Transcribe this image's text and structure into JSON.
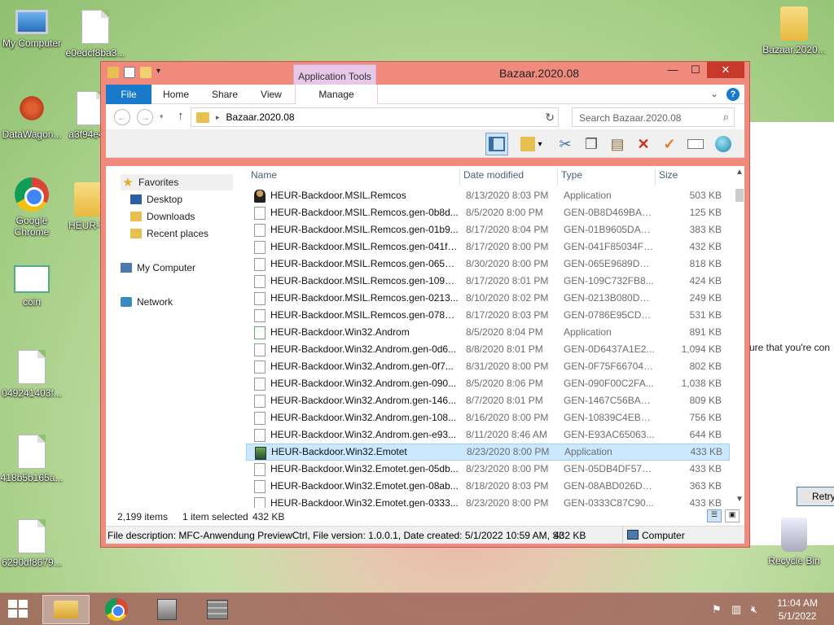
{
  "desktop": {
    "icons": [
      {
        "label": "My Computer"
      },
      {
        "label": "e0edcf8ba3..."
      },
      {
        "label": "DataWagon..."
      },
      {
        "label": "a3f94e4..."
      },
      {
        "label": "Google Chrome"
      },
      {
        "label": "HEUR-T..."
      },
      {
        "label": "coin"
      },
      {
        "label": "049241403f..."
      },
      {
        "label": "418b5b165a..."
      },
      {
        "label": "6290df8679..."
      },
      {
        "label": "Bazaar.2020..."
      },
      {
        "label": "Recycle Bin"
      }
    ],
    "background_panel": {
      "message": "ure that you're con",
      "retry_label": "Retry"
    }
  },
  "window": {
    "title": "Bazaar.2020.08",
    "contextual_tab": "Application Tools",
    "controls": {
      "minimize": "—",
      "maximize": "☐",
      "close": "✕"
    },
    "ribbon_tabs": [
      "File",
      "Home",
      "Share",
      "View"
    ],
    "manage_tab": "Manage",
    "address": {
      "path": "Bazaar.2020.08",
      "separator": "▸"
    },
    "search": {
      "placeholder": "Search Bazaar.2020.08"
    },
    "nav": {
      "favorites": "Favorites",
      "desktop": "Desktop",
      "downloads": "Downloads",
      "recent": "Recent places",
      "my_computer": "My Computer",
      "network": "Network"
    },
    "columns": {
      "name": "Name",
      "date": "Date modified",
      "type": "Type",
      "size": "Size"
    },
    "files": [
      {
        "name": "HEUR-Backdoor.MSIL.Remcos",
        "date": "8/13/2020 8:03 PM",
        "type": "Application",
        "size": "503 KB",
        "icon": "person"
      },
      {
        "name": "HEUR-Backdoor.MSIL.Remcos.gen-0b8d...",
        "date": "8/5/2020 8:00 PM",
        "type": "GEN-0B8D469BAB...",
        "size": "125 KB",
        "icon": "blank"
      },
      {
        "name": "HEUR-Backdoor.MSIL.Remcos.gen-01b9...",
        "date": "8/17/2020 8:04 PM",
        "type": "GEN-01B9605DAA...",
        "size": "383 KB",
        "icon": "blank"
      },
      {
        "name": "HEUR-Backdoor.MSIL.Remcos.gen-041f8...",
        "date": "8/17/2020 8:00 PM",
        "type": "GEN-041F85034F7...",
        "size": "432 KB",
        "icon": "blank"
      },
      {
        "name": "HEUR-Backdoor.MSIL.Remcos.gen-065e9...",
        "date": "8/30/2020 8:00 PM",
        "type": "GEN-065E9689D2B...",
        "size": "818 KB",
        "icon": "blank"
      },
      {
        "name": "HEUR-Backdoor.MSIL.Remcos.gen-109c7...",
        "date": "8/17/2020 8:01 PM",
        "type": "GEN-109C732FB8...",
        "size": "424 KB",
        "icon": "blank"
      },
      {
        "name": "HEUR-Backdoor.MSIL.Remcos.gen-0213...",
        "date": "8/10/2020 8:02 PM",
        "type": "GEN-0213B080D6E...",
        "size": "249 KB",
        "icon": "blank"
      },
      {
        "name": "HEUR-Backdoor.MSIL.Remcos.gen-0786e...",
        "date": "8/17/2020 8:03 PM",
        "type": "GEN-0786E95CD6...",
        "size": "531 KB",
        "icon": "blank"
      },
      {
        "name": "HEUR-Backdoor.Win32.Androm",
        "date": "8/5/2020 8:04 PM",
        "type": "Application",
        "size": "891 KB",
        "icon": "scroll"
      },
      {
        "name": "HEUR-Backdoor.Win32.Androm.gen-0d6...",
        "date": "8/8/2020 8:01 PM",
        "type": "GEN-0D6437A1E2...",
        "size": "1,094 KB",
        "icon": "blank"
      },
      {
        "name": "HEUR-Backdoor.Win32.Androm.gen-0f7...",
        "date": "8/31/2020 8:00 PM",
        "type": "GEN-0F75F667048...",
        "size": "802 KB",
        "icon": "blank"
      },
      {
        "name": "HEUR-Backdoor.Win32.Androm.gen-090...",
        "date": "8/5/2020 8:06 PM",
        "type": "GEN-090F00C2FA...",
        "size": "1,038 KB",
        "icon": "blank"
      },
      {
        "name": "HEUR-Backdoor.Win32.Androm.gen-146...",
        "date": "8/7/2020 8:01 PM",
        "type": "GEN-1467C56BAB...",
        "size": "809 KB",
        "icon": "blank"
      },
      {
        "name": "HEUR-Backdoor.Win32.Androm.gen-108...",
        "date": "8/16/2020 8:00 PM",
        "type": "GEN-10839C4EB55...",
        "size": "756 KB",
        "icon": "blank"
      },
      {
        "name": "HEUR-Backdoor.Win32.Androm.gen-e93...",
        "date": "8/11/2020 8:46 AM",
        "type": "GEN-E93AC65063...",
        "size": "644 KB",
        "icon": "blank"
      },
      {
        "name": "HEUR-Backdoor.Win32.Emotet",
        "date": "8/23/2020 8:00 PM",
        "type": "Application",
        "size": "433 KB",
        "icon": "app",
        "selected": true
      },
      {
        "name": "HEUR-Backdoor.Win32.Emotet.gen-05db...",
        "date": "8/23/2020 8:00 PM",
        "type": "GEN-05DB4DF57A...",
        "size": "433 KB",
        "icon": "blank"
      },
      {
        "name": "HEUR-Backdoor.Win32.Emotet.gen-08ab...",
        "date": "8/18/2020 8:03 PM",
        "type": "GEN-08ABD026D6...",
        "size": "363 KB",
        "icon": "blank"
      },
      {
        "name": "HEUR-Backdoor.Win32.Emotet.gen-0333...",
        "date": "8/23/2020 8:00 PM",
        "type": "GEN-0333C87C90...",
        "size": "433 KB",
        "icon": "blank"
      }
    ],
    "status": {
      "items": "2,199 items",
      "selected": "1 item selected",
      "selected_size": "432 KB"
    },
    "infobar": {
      "description": "File description: MFC-Anwendung PreviewCtrl, File version: 1.0.0.1, Date created: 5/1/2022 10:59 AM, Si:",
      "size": "432 KB",
      "location": "Computer"
    }
  },
  "taskbar": {
    "clock_time": "11:04 AM",
    "clock_date": "5/1/2022"
  }
}
